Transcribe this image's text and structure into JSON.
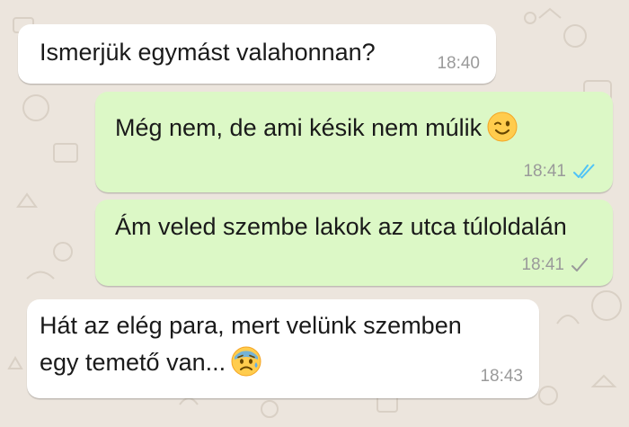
{
  "chat": {
    "messages": [
      {
        "direction": "incoming",
        "text": "Ismerjük egymást valahonnan?",
        "time": "18:40"
      },
      {
        "direction": "outgoing",
        "text": "Még nem, de ami késik nem múlik",
        "emoji": "winking-face-emoji",
        "time": "18:41",
        "status": "read",
        "status_icon": "double-check-icon",
        "status_color": "#4fc3f7"
      },
      {
        "direction": "outgoing",
        "text": "Ám veled szembe lakok az utca túloldalán",
        "time": "18:41",
        "status": "sent",
        "status_icon": "single-check-icon",
        "status_color": "#9a9a9a"
      },
      {
        "direction": "incoming",
        "text_lines": [
          "Hát az elég para, mert velünk szemben",
          "egy temető van..."
        ],
        "emoji": "anxious-face-with-sweat-emoji",
        "time": "18:43"
      }
    ]
  },
  "colors": {
    "background": "#ece5dd",
    "incoming_bubble": "#ffffff",
    "outgoing_bubble": "#dcf8c6",
    "read_tick": "#4fc3f7"
  }
}
